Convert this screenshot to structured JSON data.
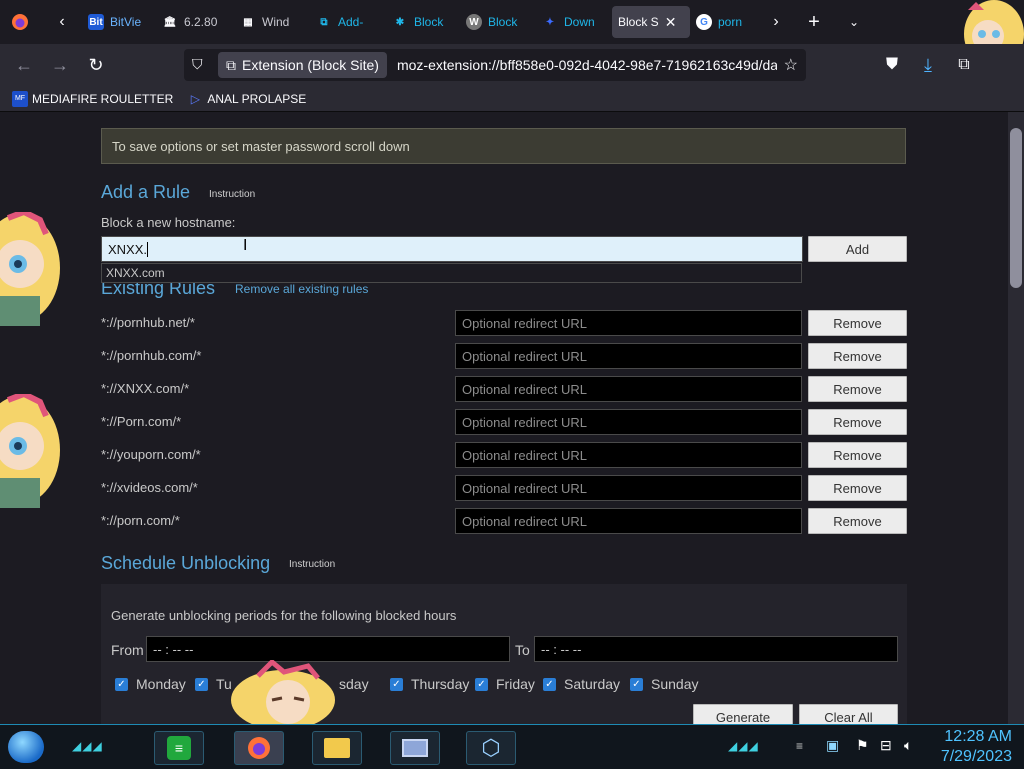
{
  "browser": {
    "tabs": [
      {
        "label": "BitVie",
        "icon": "bitview-favicon",
        "fav_text": "Bit"
      },
      {
        "label": "6.2.80",
        "icon": "library-favicon",
        "fav_text": "🏛"
      },
      {
        "label": "Wind",
        "icon": "windows-favicon",
        "fav_text": "▦"
      },
      {
        "label": "Add-",
        "icon": "puzzle-favicon",
        "fav_text": "⧉"
      },
      {
        "label": "Block",
        "icon": "block-favicon",
        "fav_text": "✱"
      },
      {
        "label": "Block",
        "icon": "w-favicon",
        "fav_text": "W"
      },
      {
        "label": "Down",
        "icon": "download-favicon",
        "fav_text": "✦"
      },
      {
        "label": "Block S",
        "icon": "active-tab",
        "fav_text": ""
      },
      {
        "label": "porn",
        "icon": "google-favicon",
        "fav_text": "G"
      }
    ],
    "identity_label": "Extension (Block Site)",
    "url": "moz-extension://bff858e0-092d-4042-98e7-71962163c49d/da",
    "bookmarks": [
      {
        "label": "MEDIAFIRE ROULETTER",
        "fav_text": "MF"
      },
      {
        "label": "ANAL PROLAPSE",
        "fav_text": "▷"
      }
    ]
  },
  "page": {
    "notice": "To save options or set master password scroll down",
    "add_rule": {
      "title": "Add a Rule",
      "instruction": "Instruction",
      "label": "Block a new hostname:",
      "input_value": "XNXX.",
      "suggestion": "XNXX.com",
      "add_button": "Add"
    },
    "existing": {
      "title": "Existing Rules",
      "remove_all": "Remove all existing rules",
      "redirect_placeholder": "Optional redirect URL",
      "remove_label": "Remove",
      "rules": [
        "*://pornhub.net/*",
        "*://pornhub.com/*",
        "*://XNXX.com/*",
        "*://Porn.com/*",
        "*://youporn.com/*",
        "*://xvideos.com/*",
        "*://porn.com/*"
      ]
    },
    "schedule": {
      "title": "Schedule Unblocking",
      "instruction": "Instruction",
      "desc": "Generate unblocking periods for the following blocked hours",
      "from_label": "From",
      "to_label": "To",
      "time_placeholder": "-- : --  --",
      "days": [
        "Monday",
        "Tu",
        "sday",
        "Thursday",
        "Friday",
        "Saturday",
        "Sunday"
      ],
      "generate": "Generate",
      "clear_all": "Clear All"
    }
  },
  "taskbar": {
    "time": "12:28 AM",
    "date": "7/29/2023"
  },
  "colors": {
    "accent": "#5aa7d8",
    "checkbox": "#2a7ed6",
    "clock": "#4fc3ff"
  }
}
